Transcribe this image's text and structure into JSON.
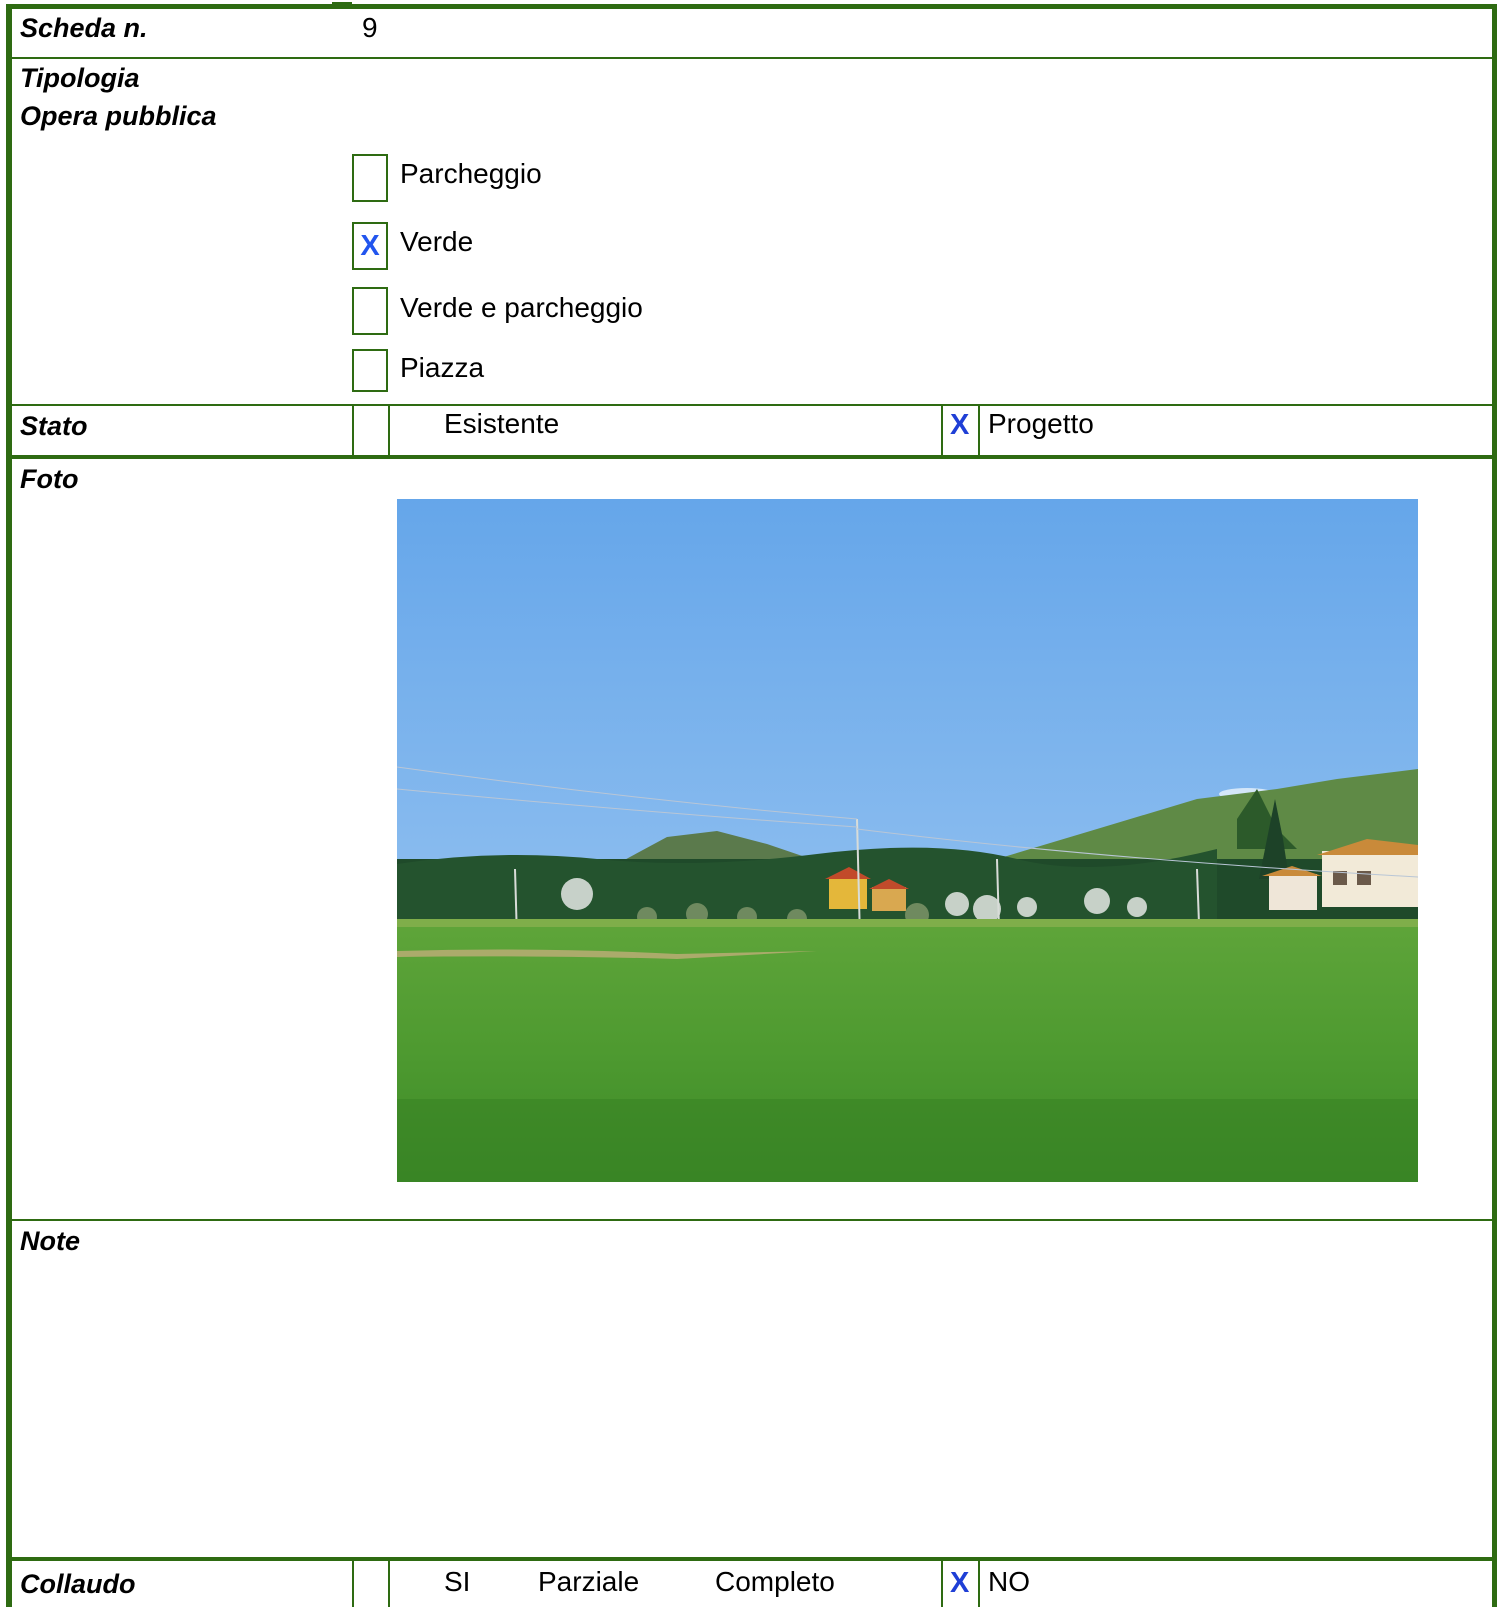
{
  "scheda": {
    "label": "Scheda n.",
    "value": "9"
  },
  "tipologia": {
    "label_line1": "Tipologia",
    "label_line2": "Opera pubblica",
    "options": [
      {
        "label": "Parcheggio",
        "mark": ""
      },
      {
        "label": "Verde",
        "mark": "X"
      },
      {
        "label": "Verde e parcheggio",
        "mark": ""
      },
      {
        "label": "Piazza",
        "mark": ""
      }
    ]
  },
  "stato": {
    "label": "Stato",
    "esistente_mark": "",
    "esistente_label": "Esistente",
    "progetto_mark": "X",
    "progetto_label": "Progetto"
  },
  "foto": {
    "label": "Foto"
  },
  "note": {
    "label": "Note"
  },
  "collaudo": {
    "label": "Collaudo",
    "si_mark": "",
    "si_label": "SI",
    "parziale_label": "Parziale",
    "completo_label": "Completo",
    "no_mark": "X",
    "no_label": "NO"
  },
  "colors": {
    "border": "#2e6b12",
    "mark": "#1f3fd6"
  }
}
